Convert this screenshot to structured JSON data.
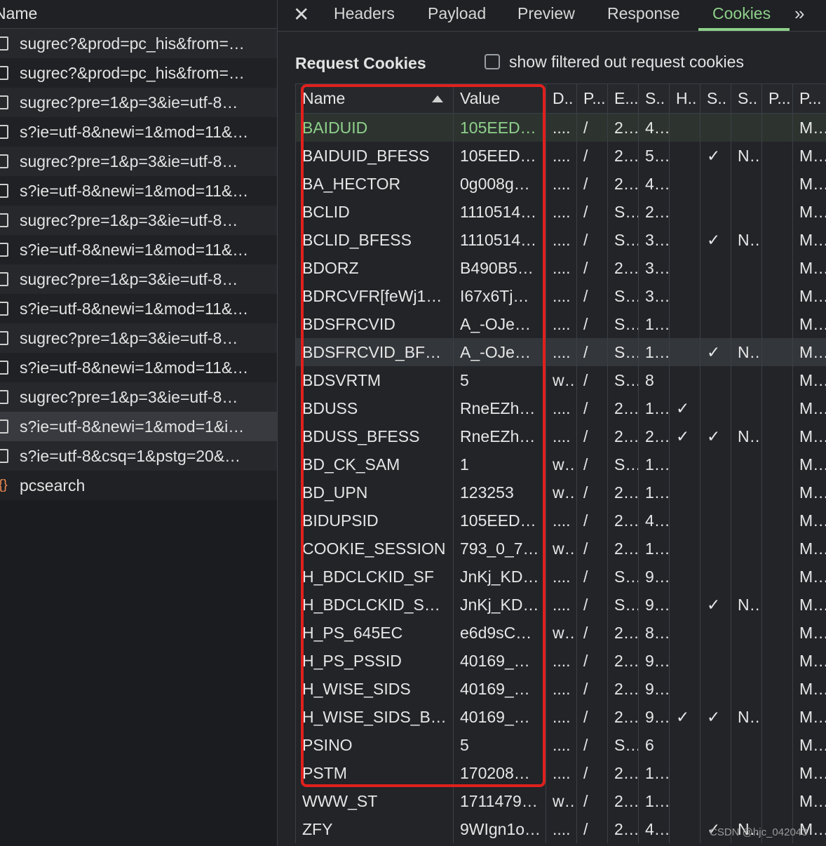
{
  "requests_panel": {
    "header": "Name",
    "items": [
      {
        "label": "sugrec?&prod=pc_his&from=…",
        "icon": "file-icon"
      },
      {
        "label": "sugrec?&prod=pc_his&from=…",
        "icon": "file-icon"
      },
      {
        "label": "sugrec?pre=1&p=3&ie=utf-8…",
        "icon": "file-icon"
      },
      {
        "label": "s?ie=utf-8&newi=1&mod=11&…",
        "icon": "file-icon"
      },
      {
        "label": "sugrec?pre=1&p=3&ie=utf-8…",
        "icon": "file-icon"
      },
      {
        "label": "s?ie=utf-8&newi=1&mod=11&…",
        "icon": "file-icon"
      },
      {
        "label": "sugrec?pre=1&p=3&ie=utf-8…",
        "icon": "file-icon"
      },
      {
        "label": "s?ie=utf-8&newi=1&mod=11&…",
        "icon": "file-icon"
      },
      {
        "label": "sugrec?pre=1&p=3&ie=utf-8…",
        "icon": "file-icon"
      },
      {
        "label": "s?ie=utf-8&newi=1&mod=11&…",
        "icon": "file-icon"
      },
      {
        "label": "sugrec?pre=1&p=3&ie=utf-8…",
        "icon": "file-icon"
      },
      {
        "label": "s?ie=utf-8&newi=1&mod=11&…",
        "icon": "file-icon"
      },
      {
        "label": "sugrec?pre=1&p=3&ie=utf-8…",
        "icon": "file-icon"
      },
      {
        "label": "s?ie=utf-8&newi=1&mod=1&i…",
        "icon": "file-icon",
        "selected": true
      },
      {
        "label": "s?ie=utf-8&csq=1&pstg=20&…",
        "icon": "file-icon"
      },
      {
        "label": "pcsearch",
        "icon": "xhr-icon"
      }
    ]
  },
  "tabs": {
    "close_glyph": "✕",
    "items": [
      "Headers",
      "Payload",
      "Preview",
      "Response",
      "Cookies"
    ],
    "active": "Cookies",
    "more_glyph": "»"
  },
  "cookies": {
    "section_title": "Request Cookies",
    "filter_label": "show filtered out request cookies",
    "columns": [
      "Name",
      "Value",
      "D..",
      "P...",
      "E...",
      "S..",
      "H..",
      "S..",
      "S..",
      "P...",
      "P..."
    ],
    "rows": [
      [
        "BAIDUID",
        "105EED…",
        "....",
        "/",
        "2…",
        "4…",
        "",
        "",
        "",
        "",
        "M…"
      ],
      [
        "BAIDUID_BFESS",
        "105EED…",
        "....",
        "/",
        "2…",
        "5…",
        "",
        "✓",
        "N…",
        "",
        "M…"
      ],
      [
        "BA_HECTOR",
        "0g008g…",
        "....",
        "/",
        "2…",
        "4…",
        "",
        "",
        "",
        "",
        "M…"
      ],
      [
        "BCLID",
        "1110514…",
        "....",
        "/",
        "S…",
        "2…",
        "",
        "",
        "",
        "",
        "M…"
      ],
      [
        "BCLID_BFESS",
        "1110514…",
        "....",
        "/",
        "S…",
        "3…",
        "",
        "✓",
        "N…",
        "",
        "M…"
      ],
      [
        "BDORZ",
        "B490B5…",
        "....",
        "/",
        "2…",
        "3…",
        "",
        "",
        "",
        "",
        "M…"
      ],
      [
        "BDRCVFR[feWj1…",
        "I67x6Tj…",
        "....",
        "/",
        "S…",
        "3…",
        "",
        "",
        "",
        "",
        "M…"
      ],
      [
        "BDSFRCVID",
        "A_-OJe…",
        "....",
        "/",
        "S…",
        "1…",
        "",
        "",
        "",
        "",
        "M…"
      ],
      [
        "BDSFRCVID_BF…",
        "A_-OJe…",
        "....",
        "/",
        "S…",
        "1…",
        "",
        "✓",
        "N…",
        "",
        "M…"
      ],
      [
        "BDSVRTM",
        "5",
        "w…",
        "/",
        "S…",
        "8",
        "",
        "",
        "",
        "",
        "M…"
      ],
      [
        "BDUSS",
        "RneEZh…",
        "....",
        "/",
        "2…",
        "1…",
        "✓",
        "",
        "",
        "",
        "M…"
      ],
      [
        "BDUSS_BFESS",
        "RneEZh…",
        "....",
        "/",
        "2…",
        "2…",
        "✓",
        "✓",
        "N…",
        "",
        "M…"
      ],
      [
        "BD_CK_SAM",
        "1",
        "w…",
        "/",
        "S…",
        "1…",
        "",
        "",
        "",
        "",
        "M…"
      ],
      [
        "BD_UPN",
        "123253",
        "w…",
        "/",
        "2…",
        "1…",
        "",
        "",
        "",
        "",
        "M…"
      ],
      [
        "BIDUPSID",
        "105EED…",
        "....",
        "/",
        "2…",
        "4…",
        "",
        "",
        "",
        "",
        "M…"
      ],
      [
        "COOKIE_SESSION",
        "793_0_7…",
        "w…",
        "/",
        "2…",
        "1…",
        "",
        "",
        "",
        "",
        "M…"
      ],
      [
        "H_BDCLCKID_SF",
        "JnKj_KD…",
        "....",
        "/",
        "S…",
        "9…",
        "",
        "",
        "",
        "",
        "M…"
      ],
      [
        "H_BDCLCKID_S…",
        "JnKj_KD…",
        "....",
        "/",
        "S…",
        "9…",
        "",
        "✓",
        "N…",
        "",
        "M…"
      ],
      [
        "H_PS_645EC",
        "e6d9sC…",
        "w…",
        "/",
        "2…",
        "8…",
        "",
        "",
        "",
        "",
        "M…"
      ],
      [
        "H_PS_PSSID",
        "40169_…",
        "....",
        "/",
        "2…",
        "9…",
        "",
        "",
        "",
        "",
        "M…"
      ],
      [
        "H_WISE_SIDS",
        "40169_…",
        "....",
        "/",
        "2…",
        "9…",
        "",
        "",
        "",
        "",
        "M…"
      ],
      [
        "H_WISE_SIDS_B…",
        "40169_…",
        "....",
        "/",
        "2…",
        "9…",
        "✓",
        "✓",
        "N…",
        "",
        "M…"
      ],
      [
        "PSINO",
        "5",
        "....",
        "/",
        "S…",
        "6",
        "",
        "",
        "",
        "",
        "M…"
      ],
      [
        "PSTM",
        "170208…",
        "....",
        "/",
        "2…",
        "1…",
        "",
        "",
        "",
        "",
        "M…"
      ],
      [
        "WWW_ST",
        "1711479…",
        "w…",
        "/",
        "2…",
        "1…",
        "",
        "",
        "",
        "",
        "M…"
      ],
      [
        "ZFY",
        "9WIgn1o…",
        "....",
        "/",
        "2…",
        "4…",
        "",
        "✓",
        "N…",
        "",
        "M…"
      ]
    ]
  },
  "annotation_color": "#e0201e",
  "accent_color": "#8ed08a",
  "watermark": "CSDN @hjc_042043"
}
